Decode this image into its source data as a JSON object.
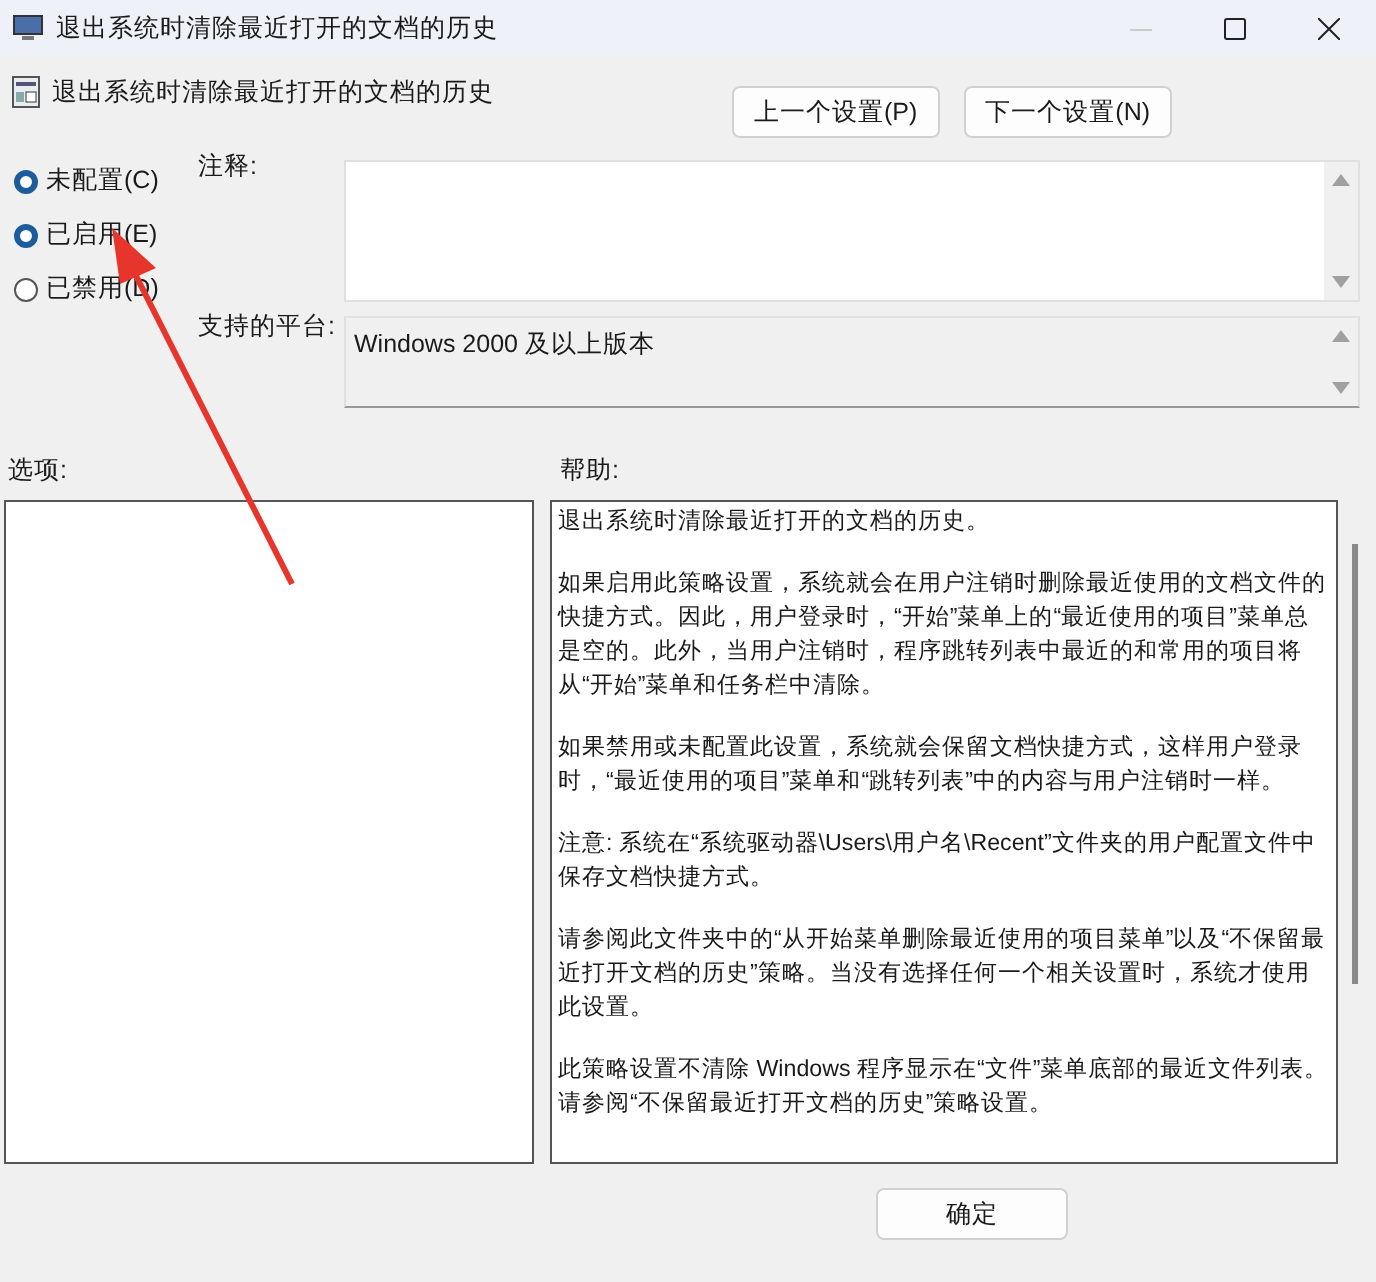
{
  "window": {
    "title": "退出系统时清除最近打开的文档的历史"
  },
  "header": {
    "title": "退出系统时清除最近打开的文档的历史",
    "buttons": [
      "上一个设置(P)",
      "下一个设置(N)"
    ]
  },
  "states": [
    {
      "label": "未配置(C)",
      "selected": true
    },
    {
      "label": "已启用(E)",
      "selected": true
    },
    {
      "label": "已禁用(D)",
      "selected": false
    }
  ],
  "comment": {
    "label": "注释:"
  },
  "platform": {
    "label": "支持的平台:",
    "value": "Windows 2000 及以上版本"
  },
  "options": {
    "label": "选项:"
  },
  "help": {
    "label": "帮助:",
    "paragraphs": [
      "退出系统时清除最近打开的文档的历史。",
      "如果启用此策略设置，系统就会在用户注销时删除最近使用的文档文件的快捷方式。因此，用户登录时，“开始”菜单上的“最近使用的项目”菜单总是空的。此外，当用户注销时，程序跳转列表中最近的和常用的项目将从“开始”菜单和任务栏中清除。",
      "如果禁用或未配置此设置，系统就会保留文档快捷方式，这样用户登录时，“最近使用的项目”菜单和“跳转列表”中的内容与用户注销时一样。",
      "注意: 系统在“系统驱动器\\Users\\用户名\\Recent”文件夹的用户配置文件中保存文档快捷方式。",
      "请参阅此文件夹中的“从开始菜单删除最近使用的项目菜单”以及“不保留最近打开文档的历史”策略。当没有选择任何一个相关设置时，系统才使用此设置。",
      "此策略设置不清除 Windows 程序显示在“文件”菜单底部的最近文件列表。请参阅“不保留最近打开文档的历史”策略设置。"
    ]
  },
  "footer": {
    "buttons": [
      "确定"
    ]
  }
}
